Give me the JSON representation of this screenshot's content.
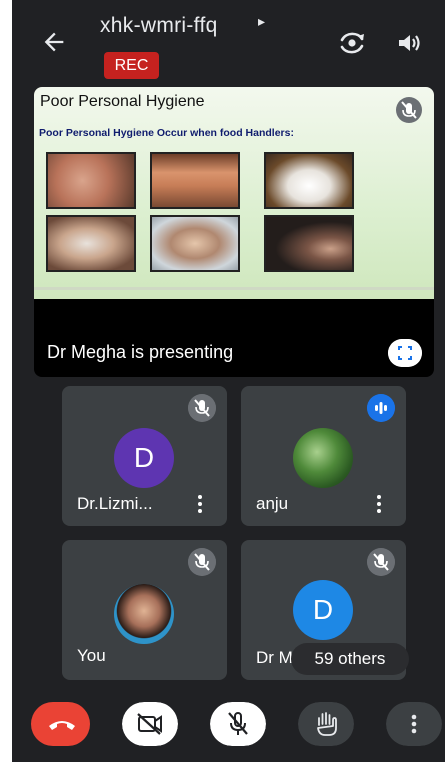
{
  "meeting": {
    "code": "xhk-wmri-ffq",
    "code_caret": "▸",
    "recording_badge": "REC"
  },
  "presentation": {
    "slide_title": "Poor Personal Hygiene",
    "slide_subtitle": "Poor Personal Hygiene Occur when food Handlers:",
    "presenting_text": "Dr Megha is presenting"
  },
  "participants": [
    {
      "name": "Dr.Lizmi...",
      "avatar_letter": "D",
      "avatar_color": "#5e35b1",
      "muted": true
    },
    {
      "name": "anju",
      "avatar_letter": "",
      "speaking": true
    },
    {
      "name": "You",
      "avatar_letter": "",
      "muted": true
    },
    {
      "name": "Dr M",
      "avatar_letter": "D",
      "avatar_color": "#1e88e5",
      "muted": true
    }
  ],
  "overflow": {
    "label": "59 others"
  },
  "colors": {
    "background": "#202124",
    "tile": "#3c4043",
    "rec_badge": "#c5221f",
    "end_call": "#ea4335",
    "speaking": "#1a73e8"
  },
  "controls": [
    "end-call",
    "camera-off",
    "mic-off",
    "raise-hand",
    "more-options"
  ]
}
